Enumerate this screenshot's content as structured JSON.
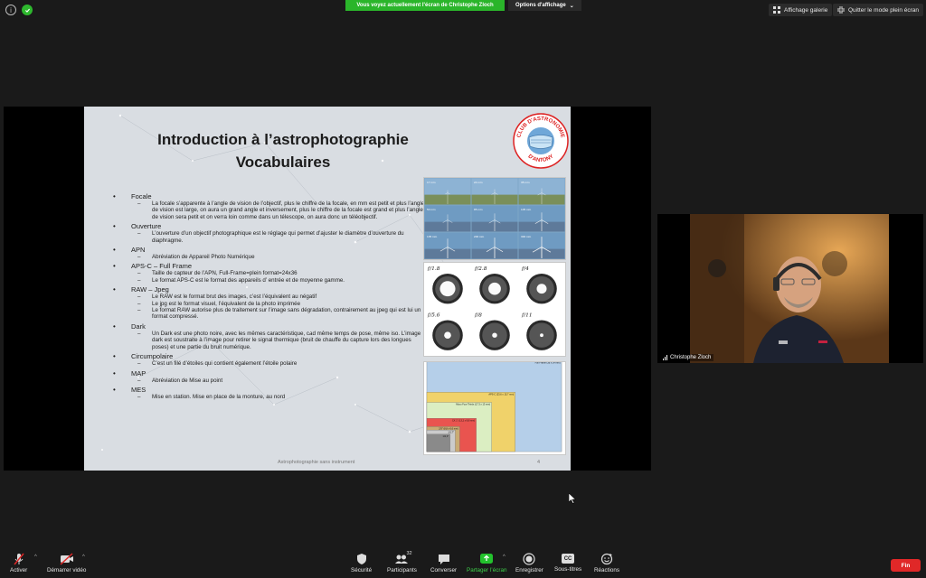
{
  "topbar": {
    "share_banner": "Vous voyez actuellement l'écran de Christophe Zloch",
    "view_options": "Options d'affichage",
    "gallery_view": "Affichage galerie",
    "exit_fullscreen": "Quitter le mode plein écran"
  },
  "slide": {
    "title_line1": "Introduction à l’astrophotographie",
    "title_line2": "Vocabulaires",
    "logo_text_top": "CLUB D'ASTRONOMIE",
    "logo_text_bottom": "D'ANTONY",
    "footer": "Astrophotographie sans instrument",
    "page_number": "4",
    "bullets": [
      {
        "term": "Focale",
        "subs": [
          "La focale s’apparente à l’angle de vision de l’objectif, plus le chiffre de la focale, en mm est petit et plus l’angle de vision est large, on aura un grand angle et inversement, plus le chiffre de la focale est grand et plus l’angle de vision sera petit et on verra loin comme dans un télescope, on aura donc un téléobjectif."
        ]
      },
      {
        "term": "Ouverture",
        "subs": [
          "L’ouverture d’un objectif photographique est le réglage qui permet d’ajuster le diamètre d’ouverture du diaphragme."
        ]
      },
      {
        "term": "APN",
        "subs": [
          "Abréviation de Appareil Photo Numérique"
        ]
      },
      {
        "term": "APS-C – Full Frame",
        "subs": [
          "Taille de capteur de l’APN, Full-Frame=plein format=24x36",
          "Le format APS-C est le format des appareils d’ entrée et de moyenne gamme."
        ]
      },
      {
        "term": "RAW – Jpeg",
        "subs": [
          "Le RAW est le format brut des images, c’est l’équivalent au négatif",
          "Le jpg est le format visuel, l’équivalent de la photo imprimée",
          "Le format RAW autorise plus de traitement sur l’image sans dégradation, contrairement au jpeg qui est lui un format compressé."
        ]
      },
      {
        "term": "Dark",
        "subs": [
          "Un Dark est une photo noire, avec les mêmes caractéristique, cad même temps de pose, même iso. L’image dark est soustraite à l’image pour retirer le signal thermique (bruit de chauffe du capture lors des longues poses) et une partie du bruit numérique."
        ]
      },
      {
        "term": "Circumpolaire",
        "subs": [
          "C’est un filé d’étoiles qui contient également l’étoile polaire"
        ]
      },
      {
        "term": "MAP",
        "subs": [
          "Abréviation de Mise au point"
        ]
      },
      {
        "term": "MES",
        "subs": [
          "Mise en station. Mise en place de la monture, au nord"
        ]
      }
    ],
    "focal_panel": {
      "labels": [
        "17 mm",
        "24 mm",
        "35 mm",
        "50 mm",
        "85 mm",
        "105 mm",
        "135 mm",
        "200 mm",
        "300 mm"
      ]
    },
    "aperture_panel": {
      "labels": [
        "f/1.8",
        "f/2.8",
        "f/4",
        "f/5.6",
        "f/8",
        "f/11"
      ],
      "openings": [
        0.62,
        0.5,
        0.4,
        0.28,
        0.2,
        0.14
      ]
    },
    "sensor_panel": {
      "labels": [
        "Full Frame (36 x 24 mm)",
        "APS-C (23,6 x 15,7 mm)",
        "Micro Four Thirds (17,3 x 13 mm)",
        "CX 1\" (13,2 x 8,8 mm)",
        "2/3\" (8,8 x 6,6 mm)",
        "1/1,7\"",
        "1/2,3\""
      ],
      "colors": [
        "#b5cfe9",
        "#f0d26a",
        "#dbeec2",
        "#e9544f",
        "#c9ab73",
        "#cbcbcb",
        "#8a8a8a"
      ]
    }
  },
  "participant": {
    "name": "Christophe Zloch"
  },
  "toolbar": {
    "mute": "Activer",
    "video": "Démarrer vidéo",
    "security": "Sécurité",
    "participants": "Participants",
    "participants_count": "32",
    "chat": "Converser",
    "share": "Partager l’écran",
    "record": "Enregistrer",
    "subtitles": "Sous-titres",
    "subtitles_icon_text": "CC",
    "reactions": "Réactions",
    "end": "Fin"
  },
  "colors": {
    "share_green": "#2ab52a",
    "end_red": "#e02828",
    "share_icon_green": "#23c22d",
    "muted_red": "#e02828"
  }
}
